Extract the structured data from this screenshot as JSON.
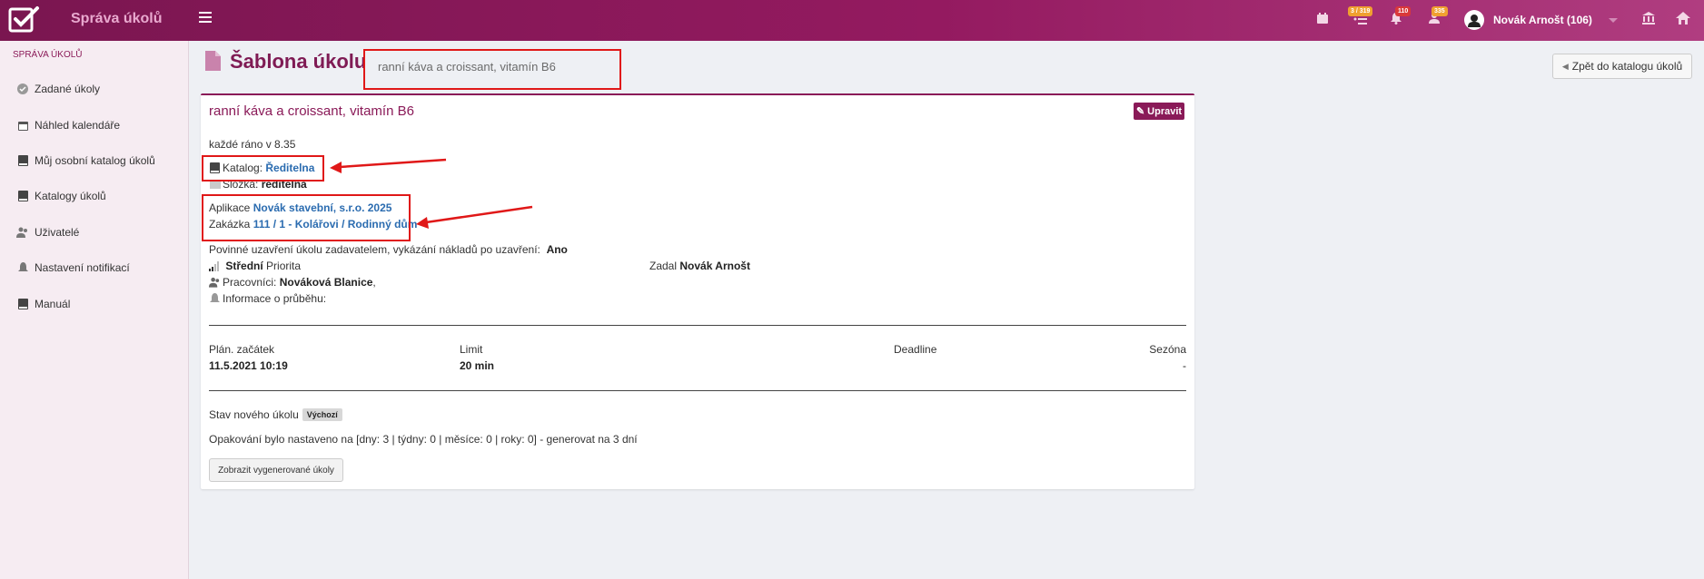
{
  "topbar": {
    "app_title": "Správa úkolů",
    "badges": {
      "tasks": "3 / 319",
      "alerts": "110",
      "team": "335"
    },
    "user_name": "Novák Arnošt (106)"
  },
  "sidebar": {
    "header": "SPRÁVA ÚKOLŮ",
    "items": [
      {
        "label": "Zadané úkoly",
        "icon": "check-circle-icon"
      },
      {
        "label": "Náhled kalendáře",
        "icon": "calendar-icon"
      },
      {
        "label": "Můj osobní katalog úkolů",
        "icon": "book-icon"
      },
      {
        "label": "Katalogy úkolů",
        "icon": "book-icon"
      },
      {
        "label": "Uživatelé",
        "icon": "users-icon"
      },
      {
        "label": "Nastavení notifikací",
        "icon": "bell-icon"
      },
      {
        "label": "Manuál",
        "icon": "book-icon"
      }
    ]
  },
  "page": {
    "title": "Šablona úkolu",
    "subtitle": "ranní káva a croissant, vitamín B6",
    "back_label": "Zpět do katalogu úkolů"
  },
  "card": {
    "title": "ranní káva a croissant, vitamín B6",
    "edit_label": "Upravit",
    "description": "každé ráno v 8.35",
    "catalog_label": "Katalog:",
    "catalog_value": "Ředitelna",
    "folder_label": "Složka:",
    "folder_value": "ředitelna",
    "app_label": "Aplikace",
    "app_value": "Novák stavební, s.r.o. 2025",
    "order_label": "Zakázka",
    "order_value": "111 / 1 - Kolářovi / Rodinný dům",
    "mandatory_label": "Povinné uzavření úkolu zadavatelem, vykázání nákladů po uzavření:",
    "mandatory_value": "Ano",
    "priority_value": "Střední",
    "priority_label": "Priorita",
    "assigned_label": "Zadal",
    "assigned_value": "Novák Arnošt",
    "workers_label": "Pracovníci:",
    "workers_value": "Nováková Blanice",
    "workers_suffix": ",",
    "progress_label": "Informace o průběhu:",
    "plan_start_label": "Plán. začátek",
    "plan_start_value": "11.5.2021 10:19",
    "limit_label": "Limit",
    "limit_value": "20 min",
    "deadline_label": "Deadline",
    "season_label": "Sezóna",
    "season_value": "-",
    "state_label": "Stav nového úkolu",
    "state_value": "Výchozí",
    "repeat_text": "Opakování bylo nastaveno na [dny: 3 | týdny: 0 | měsíce: 0 | roky: 0] - generovat na 3 dní",
    "generate_label": "Zobrazit vygenerované úkoly"
  },
  "colors": {
    "brand": "#8a1a58",
    "link": "#2b6cb0",
    "annotation": "#e01818"
  }
}
